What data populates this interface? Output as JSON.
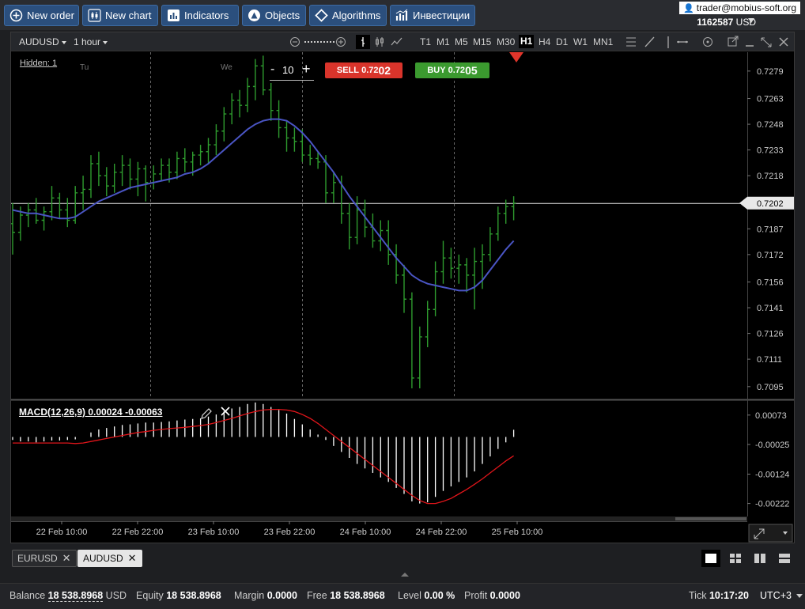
{
  "toolbar": {
    "buttons": [
      {
        "label": "New order",
        "icon": "plus-circle-icon"
      },
      {
        "label": "New chart",
        "icon": "candles-icon"
      },
      {
        "label": "Indicators",
        "icon": "bar-chart-icon"
      },
      {
        "label": "Objects",
        "icon": "shapes-icon"
      },
      {
        "label": "Algorithms",
        "icon": "diamond-icon"
      },
      {
        "label": "Инвестиции",
        "icon": "investments-icon"
      }
    ],
    "user_email": "trader@mobius-soft.org",
    "account_id": "1162587",
    "account_currency": "USD"
  },
  "chart_toolbar": {
    "symbol": "AUDUSD",
    "period": "1 hour",
    "timeframes": [
      "T1",
      "M1",
      "M5",
      "M15",
      "M30",
      "H1",
      "H4",
      "D1",
      "W1",
      "MN1"
    ],
    "active_timeframe": "H1"
  },
  "trade_panel": {
    "lot_minus": "-",
    "lot_value": "10",
    "lot_plus": "+",
    "sell_label": "SELL",
    "sell_price_small": "0.72",
    "sell_price_big": "02",
    "buy_label": "BUY",
    "buy_price_small": "0.72",
    "buy_price_big": "05"
  },
  "hidden_label": "Hidden: 1",
  "day_labels": [
    "Tu",
    "We"
  ],
  "indicator_label": "MACD(12,26,9) 0.00024 -0.00063",
  "chart_data": [
    {
      "type": "bar",
      "symbol": "AUDUSD",
      "timeframe": "H1",
      "x_tick_labels": [
        "22 Feb 10:00",
        "22 Feb 22:00",
        "23 Feb 10:00",
        "23 Feb 22:00",
        "24 Feb 10:00",
        "24 Feb 22:00",
        "25 Feb 10:00"
      ],
      "y_tick_labels": [
        "0.7279",
        "0.7263",
        "0.7248",
        "0.7233",
        "0.7218",
        "0.7202",
        "0.7187",
        "0.7172",
        "0.7156",
        "0.7141",
        "0.7126",
        "0.7111",
        "0.7095"
      ],
      "ylim": [
        0.7088,
        0.729
      ],
      "current_price": 0.7202,
      "current_price_label": "0.7202",
      "bar_color": "#2e9b2e",
      "ma_color": "#4a55c4",
      "bars": [
        [
          0.719,
          0.7202,
          0.7172,
          0.7185
        ],
        [
          0.7185,
          0.72,
          0.718,
          0.7195
        ],
        [
          0.7195,
          0.7202,
          0.7188,
          0.7198
        ],
        [
          0.7198,
          0.7205,
          0.719,
          0.7192
        ],
        [
          0.7192,
          0.72,
          0.7186,
          0.7197
        ],
        [
          0.7197,
          0.7212,
          0.7192,
          0.7205
        ],
        [
          0.7205,
          0.7208,
          0.7193,
          0.7198
        ],
        [
          0.7198,
          0.7205,
          0.7188,
          0.7192
        ],
        [
          0.7192,
          0.7212,
          0.719,
          0.7208
        ],
        [
          0.7208,
          0.7218,
          0.7198,
          0.721
        ],
        [
          0.721,
          0.723,
          0.7205,
          0.7225
        ],
        [
          0.7225,
          0.7232,
          0.7212,
          0.7218
        ],
        [
          0.7218,
          0.7223,
          0.7206,
          0.7212
        ],
        [
          0.7212,
          0.7225,
          0.7208,
          0.722
        ],
        [
          0.722,
          0.723,
          0.7212,
          0.7224
        ],
        [
          0.7224,
          0.7228,
          0.721,
          0.7216
        ],
        [
          0.7216,
          0.7226,
          0.7206,
          0.7222
        ],
        [
          0.7222,
          0.7224,
          0.7203,
          0.7214
        ],
        [
          0.7214,
          0.7224,
          0.721,
          0.7219
        ],
        [
          0.7219,
          0.7228,
          0.7215,
          0.7224
        ],
        [
          0.7224,
          0.7228,
          0.7214,
          0.722
        ],
        [
          0.722,
          0.7232,
          0.7216,
          0.7228
        ],
        [
          0.7228,
          0.7234,
          0.722,
          0.7226
        ],
        [
          0.7226,
          0.7232,
          0.7218,
          0.723
        ],
        [
          0.723,
          0.7236,
          0.7224,
          0.7232
        ],
        [
          0.7232,
          0.724,
          0.7225,
          0.7236
        ],
        [
          0.7236,
          0.7248,
          0.723,
          0.7244
        ],
        [
          0.7244,
          0.7258,
          0.7238,
          0.7254
        ],
        [
          0.7254,
          0.7266,
          0.7248,
          0.7262
        ],
        [
          0.7262,
          0.7268,
          0.7252,
          0.7259
        ],
        [
          0.7259,
          0.7275,
          0.7255,
          0.727
        ],
        [
          0.727,
          0.7286,
          0.7262,
          0.7282
        ],
        [
          0.7282,
          0.7288,
          0.7265,
          0.7268
        ],
        [
          0.7268,
          0.7272,
          0.725,
          0.7256
        ],
        [
          0.7256,
          0.7262,
          0.724,
          0.7246
        ],
        [
          0.7246,
          0.725,
          0.7232,
          0.724
        ],
        [
          0.724,
          0.7246,
          0.7232,
          0.7238
        ],
        [
          0.7238,
          0.7245,
          0.7226,
          0.723
        ],
        [
          0.723,
          0.7236,
          0.7224,
          0.7228
        ],
        [
          0.7228,
          0.7232,
          0.7222,
          0.7226
        ],
        [
          0.7226,
          0.723,
          0.7202,
          0.7208
        ],
        [
          0.7208,
          0.722,
          0.7202,
          0.7214
        ],
        [
          0.7214,
          0.7218,
          0.719,
          0.7196
        ],
        [
          0.7196,
          0.7202,
          0.7175,
          0.7182
        ],
        [
          0.7182,
          0.7206,
          0.7178,
          0.7198
        ],
        [
          0.7198,
          0.7204,
          0.7182,
          0.7188
        ],
        [
          0.7188,
          0.7196,
          0.7176,
          0.718
        ],
        [
          0.718,
          0.7192,
          0.7174,
          0.7186
        ],
        [
          0.7186,
          0.7192,
          0.7166,
          0.7172
        ],
        [
          0.7172,
          0.7178,
          0.7155,
          0.716
        ],
        [
          0.716,
          0.7166,
          0.7138,
          0.7146
        ],
        [
          0.7146,
          0.715,
          0.7094,
          0.71
        ],
        [
          0.71,
          0.713,
          0.7094,
          0.7124
        ],
        [
          0.7124,
          0.7145,
          0.7118,
          0.714
        ],
        [
          0.714,
          0.7168,
          0.7136,
          0.7162
        ],
        [
          0.7162,
          0.718,
          0.7155,
          0.717
        ],
        [
          0.717,
          0.7176,
          0.7158,
          0.7164
        ],
        [
          0.7164,
          0.7172,
          0.7155,
          0.7166
        ],
        [
          0.7166,
          0.717,
          0.715,
          0.716
        ],
        [
          0.716,
          0.7176,
          0.714,
          0.7168
        ],
        [
          0.7168,
          0.7178,
          0.7152,
          0.7172
        ],
        [
          0.7172,
          0.7188,
          0.7168,
          0.7184
        ],
        [
          0.7184,
          0.72,
          0.718,
          0.7196
        ],
        [
          0.7196,
          0.7204,
          0.719,
          0.72
        ],
        [
          0.72,
          0.7206,
          0.7192,
          0.7202
        ]
      ],
      "ma": [
        0.7198,
        0.7197,
        0.7196,
        0.7196,
        0.7195,
        0.7194,
        0.7193,
        0.7193,
        0.7194,
        0.7197,
        0.72,
        0.7203,
        0.7205,
        0.7207,
        0.7209,
        0.7211,
        0.7212,
        0.7213,
        0.7214,
        0.7215,
        0.7216,
        0.7217,
        0.7219,
        0.722,
        0.7222,
        0.7225,
        0.7229,
        0.7233,
        0.7237,
        0.7241,
        0.7245,
        0.7248,
        0.725,
        0.7251,
        0.7251,
        0.725,
        0.7247,
        0.7243,
        0.7238,
        0.7232,
        0.7226,
        0.722,
        0.7213,
        0.7206,
        0.72,
        0.7194,
        0.7188,
        0.7182,
        0.7176,
        0.717,
        0.7165,
        0.716,
        0.7157,
        0.7155,
        0.7154,
        0.7153,
        0.7152,
        0.7151,
        0.7151,
        0.7153,
        0.7157,
        0.7163,
        0.7169,
        0.7175,
        0.718
      ]
    },
    {
      "type": "bar",
      "indicator": "MACD(12,26,9)",
      "y_tick_labels": [
        "0.00073",
        "-0.00025",
        "-0.00124",
        "-0.00222"
      ],
      "ylim": [
        -0.0026,
        0.0012
      ],
      "histogram_color": "#ffffff",
      "signal_color": "#e0151a",
      "histogram": [
        -0.0001,
        -0.00015,
        -0.00015,
        -0.00018,
        -0.00015,
        -0.00012,
        -0.00012,
        -0.0001,
        -8e-05,
        0.0,
        0.00015,
        0.00025,
        0.0003,
        0.00035,
        0.0004,
        0.00042,
        0.00045,
        0.00048,
        0.00048,
        0.0005,
        0.00052,
        0.00055,
        0.00058,
        0.0006,
        0.00062,
        0.00068,
        0.00075,
        0.00085,
        0.00095,
        0.001,
        0.0011,
        0.00115,
        0.0011,
        0.001,
        0.0009,
        0.00078,
        0.0006,
        0.00042,
        0.00025,
        8e-05,
        -0.0001,
        -0.0003,
        -0.0005,
        -0.0007,
        -0.0009,
        -0.00105,
        -0.0012,
        -0.00135,
        -0.0015,
        -0.0017,
        -0.0019,
        -0.00215,
        -0.00222,
        -0.00218,
        -0.002,
        -0.0018,
        -0.00165,
        -0.0015,
        -0.00135,
        -0.00115,
        -0.0009,
        -0.00065,
        -0.0004,
        -0.00018,
        0.00024
      ],
      "signal": [
        -0.0002,
        -0.0002,
        -0.0002,
        -0.0002,
        -0.0002,
        -0.0002,
        -0.0002,
        -0.0002,
        -0.00022,
        -0.0002,
        -0.00015,
        -0.0001,
        -5e-05,
        0.0,
        5e-05,
        0.0001,
        0.00015,
        0.00018,
        0.00022,
        0.00025,
        0.00028,
        0.0003,
        0.00032,
        0.00035,
        0.00038,
        0.00042,
        0.00048,
        0.00055,
        0.00062,
        0.0007,
        0.00078,
        0.00085,
        0.0009,
        0.00092,
        0.00092,
        0.0009,
        0.00085,
        0.00075,
        0.00062,
        0.00045,
        0.00025,
        5e-05,
        -0.00015,
        -0.00035,
        -0.00055,
        -0.00075,
        -0.00095,
        -0.00115,
        -0.00135,
        -0.00155,
        -0.00175,
        -0.00195,
        -0.00212,
        -0.00222,
        -0.00222,
        -0.00215,
        -0.00205,
        -0.0019,
        -0.00175,
        -0.00158,
        -0.0014,
        -0.0012,
        -0.001,
        -0.0008,
        -0.00063
      ]
    }
  ],
  "symbol_tabs": [
    {
      "label": "EURUSD",
      "active": false
    },
    {
      "label": "AUDUSD",
      "active": true
    }
  ],
  "status": {
    "balance_label": "Balance",
    "balance_value": "18 538.8968",
    "balance_currency": "USD",
    "equity_label": "Equity",
    "equity_value": "18 538.8968",
    "margin_label": "Margin",
    "margin_value": "0.0000",
    "free_label": "Free",
    "free_value": "18 538.8968",
    "level_label": "Level",
    "level_value": "0.00 %",
    "profit_label": "Profit",
    "profit_value": "0.0000",
    "tick_label": "Tick",
    "tick_time": "10:17:20",
    "timezone": "UTC+3"
  },
  "colors": {
    "toolbar_button": "#2b4f7d",
    "sell": "#d9342b",
    "buy": "#3b9a2f",
    "background": "#000000"
  }
}
